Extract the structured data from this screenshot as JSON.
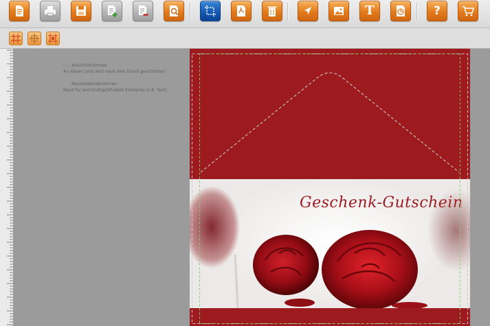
{
  "toolbar": {
    "buttons": [
      {
        "name": "new-document",
        "icon": "document-icon",
        "style": "orange"
      },
      {
        "name": "print",
        "icon": "printer-icon",
        "style": "grey"
      },
      {
        "name": "save",
        "icon": "floppy-disk-icon",
        "style": "orange"
      },
      {
        "name": "add-page",
        "icon": "add-page-icon",
        "style": "grey"
      },
      {
        "name": "remove-page",
        "icon": "remove-page-icon",
        "style": "grey"
      },
      {
        "name": "preview",
        "icon": "magnifier-document-icon",
        "style": "orange"
      },
      {
        "name": "crop-marks",
        "icon": "crop-marks-icon",
        "style": "blue"
      },
      {
        "name": "pdf-export",
        "icon": "pdf-document-icon",
        "style": "orange"
      },
      {
        "name": "delete",
        "icon": "trash-icon",
        "style": "orange"
      },
      {
        "name": "select-tool",
        "icon": "arrow-cursor-icon",
        "style": "orange"
      },
      {
        "name": "image-tool",
        "icon": "image-icon",
        "style": "orange"
      },
      {
        "name": "text-tool",
        "icon": "text-t-icon",
        "style": "orange",
        "glyph": "T"
      },
      {
        "name": "clip-art",
        "icon": "clipart-icon",
        "style": "orange"
      },
      {
        "name": "help",
        "icon": "question-icon",
        "style": "orange",
        "glyph": "?"
      },
      {
        "name": "cart",
        "icon": "shopping-cart-icon",
        "style": "orange"
      }
    ]
  },
  "subbar": {
    "buttons": [
      {
        "name": "align-grid",
        "icon": "grid-align-icon"
      },
      {
        "name": "align-center",
        "icon": "center-align-icon"
      },
      {
        "name": "distribute",
        "icon": "distribute-icon"
      }
    ]
  },
  "legend": {
    "line1": "- - - Anschnittrahmen",
    "line2": "An dieser Linie wird nach dem Druck geschnitten!",
    "line3": "Randabstandsrahmen",
    "line4": "Rand für anschnittgefährdete Elemente (z.B. Text)"
  },
  "card": {
    "title": "Geschenk-Gutschein",
    "background_color": "#9d1a1e",
    "photo_description_color": "#ffffff"
  },
  "colors": {
    "accent_orange": "#e27b1d",
    "active_blue": "#1458b2",
    "bleed_line": "#c8c8c8",
    "margin_line": "#7bd36a"
  }
}
